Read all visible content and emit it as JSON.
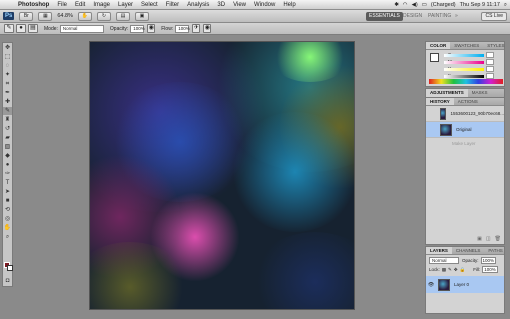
{
  "menubar": {
    "apple": "",
    "items": [
      "Photoshop",
      "File",
      "Edit",
      "Image",
      "Layer",
      "Select",
      "Filter",
      "Analysis",
      "3D",
      "View",
      "Window",
      "Help"
    ],
    "battery": "(Charged)",
    "datetime": "Thu Sep 9  11:17"
  },
  "appbar": {
    "ps_logo": "Ps",
    "zoom": "64.8%",
    "workspaces": [
      "ESSENTIALS",
      "DESIGN",
      "PAINTING",
      "»"
    ],
    "cs_live": "CS Live"
  },
  "options": {
    "mode_label": "Mode:",
    "mode_value": "Normal",
    "opacity_label": "Opacity:",
    "opacity_value": "100%",
    "flow_label": "Flow:",
    "flow_value": "100%"
  },
  "color_panel": {
    "tabs": [
      "COLOR",
      "SWATCHES",
      "STYLES"
    ],
    "channels": [
      "C",
      "M",
      "Y",
      "K"
    ]
  },
  "adjustments_panel": {
    "tabs": [
      "ADJUSTMENTS",
      "MASKS"
    ]
  },
  "history_panel": {
    "tabs": [
      "HISTORY",
      "ACTIONS"
    ],
    "items": [
      {
        "label": "1553600123_90b70ec68..."
      },
      {
        "label": "Original"
      },
      {
        "label": "Make Layer"
      }
    ]
  },
  "layers_panel": {
    "tabs": [
      "LAYERS",
      "CHANNELS",
      "PATHS"
    ],
    "blend_mode": "Normal",
    "opacity_label": "Opacity:",
    "opacity_value": "100%",
    "lock_label": "Lock:",
    "fill_label": "Fill:",
    "fill_value": "100%",
    "layer_name": "Layer 0"
  }
}
